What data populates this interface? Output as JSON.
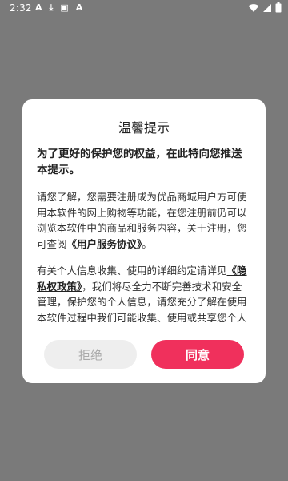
{
  "status_bar": {
    "time": "2:32",
    "left_icons": [
      "A",
      "⤓",
      "▣",
      "A"
    ]
  },
  "dialog": {
    "title": "温馨提示",
    "notice": "为了更好的保护您的权益，在此特向您推送本提示。",
    "para1_prefix": "请您了解，您需要注册成为优品商城用户方可使用本软件的网上购物等功能，在您注册前仍可以浏览本软件中的商品和服务内容，关于注册，您可查阅",
    "user_agreement_link": "《用户服务协议》",
    "para1_suffix": "。",
    "para2_prefix": "有关个人信息收集、使用的详细约定请详见",
    "privacy_link": "《隐私权政策》",
    "para2_suffix": "，我们将尽全力不断完善技术和安全管理，保护您的个人信息，请您充分了解在使用本软件过程中我们可能收集、使用或共享您个人信息的情形：",
    "reject_label": "拒绝",
    "agree_label": "同意"
  },
  "colors": {
    "backdrop": "#7a7a7a",
    "agree_button": "#f0305c",
    "reject_button": "#eeeeee"
  }
}
